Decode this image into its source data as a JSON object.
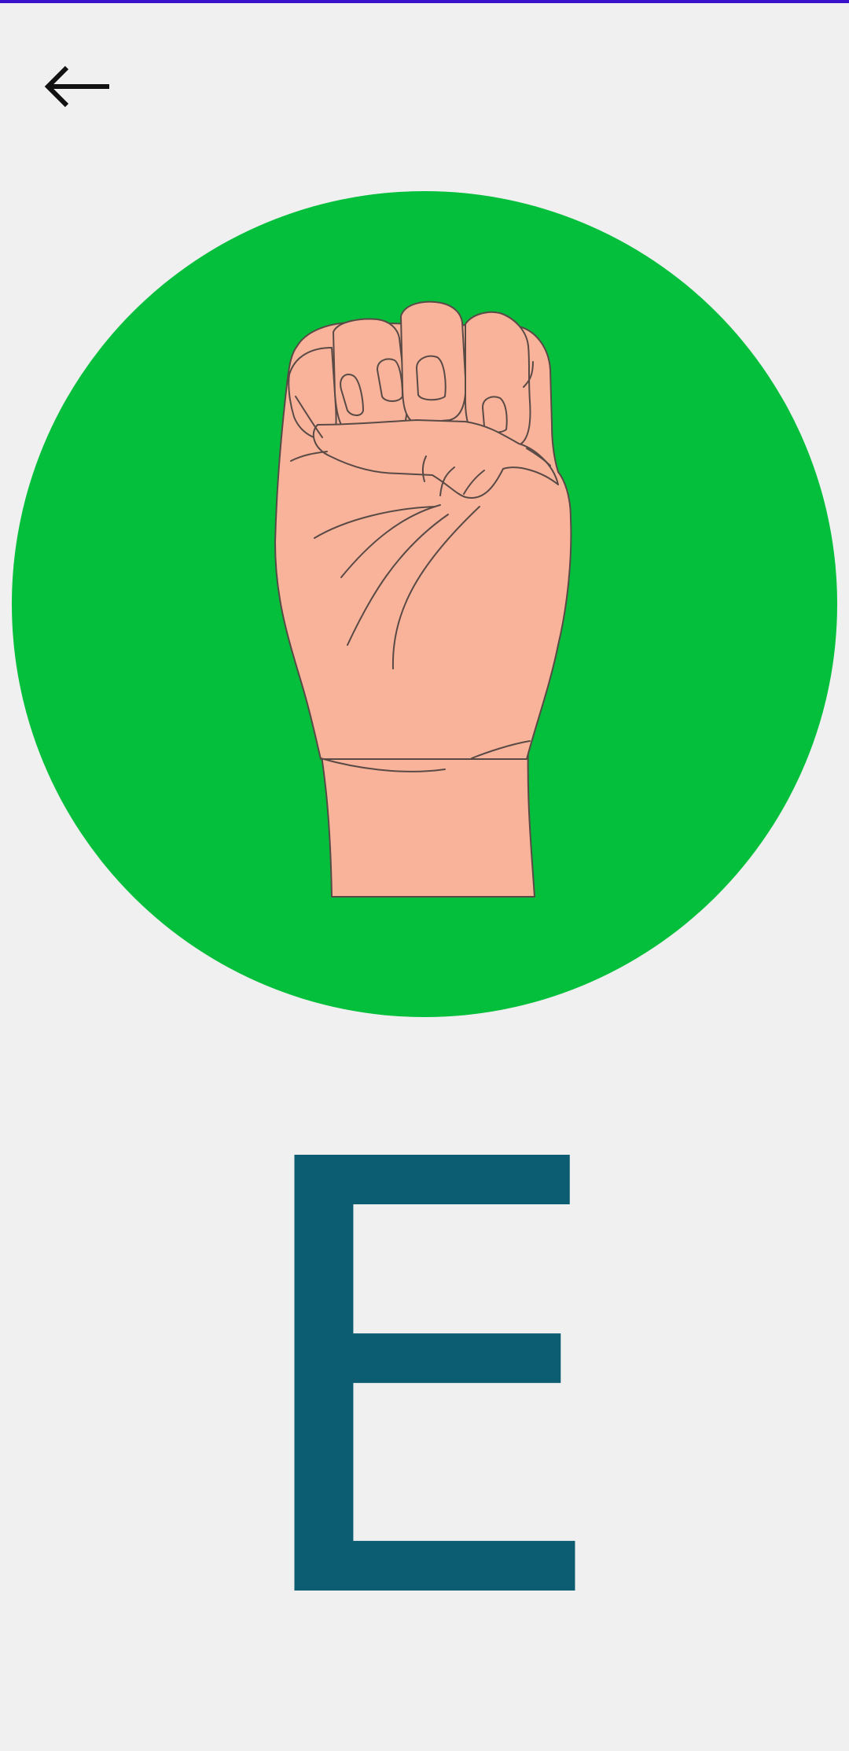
{
  "screen": {
    "letter": "E",
    "accent_bar_color": "#3a12c9",
    "circle_color": "#03bf3c",
    "letter_color": "#0d5d72",
    "background_color": "#f0f0f0"
  },
  "toolbar": {
    "back_icon": "arrow-left-icon"
  },
  "illustration": {
    "icon": "fist-hand-sign-icon",
    "skin_color": "#f8b39a",
    "outline_color": "#5a4a46"
  }
}
